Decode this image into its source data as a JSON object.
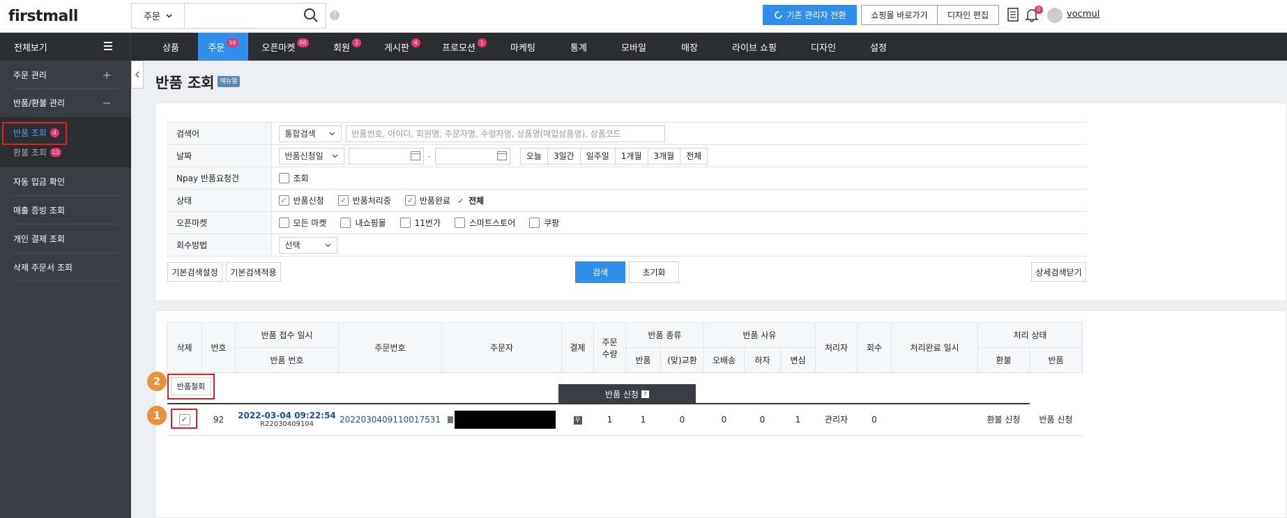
{
  "app": {
    "logo": "firstmall",
    "username": "vocmul"
  },
  "topbar": {
    "search_select": "주문",
    "help": "?",
    "switch_admin": "기존 관리자 전환",
    "go_mall": "쇼핑몰 바로가기",
    "design_edit": "디자인 편집",
    "notif_count": "0"
  },
  "nav": {
    "all": "전체보기",
    "items": [
      {
        "label": "상품",
        "badge": ""
      },
      {
        "label": "주문",
        "badge": "59"
      },
      {
        "label": "오픈마켓",
        "badge": "98"
      },
      {
        "label": "회원",
        "badge": "2"
      },
      {
        "label": "게시판",
        "badge": "4"
      },
      {
        "label": "프로모션",
        "badge": "1"
      },
      {
        "label": "마케팅",
        "badge": ""
      },
      {
        "label": "통계",
        "badge": ""
      },
      {
        "label": "모바일",
        "badge": ""
      },
      {
        "label": "매장",
        "badge": ""
      },
      {
        "label": "라이브 쇼핑",
        "badge": ""
      },
      {
        "label": "디자인",
        "badge": ""
      },
      {
        "label": "설정",
        "badge": ""
      }
    ]
  },
  "sidebar": {
    "order_mgmt": "주문 관리",
    "return_mgmt": "반품/환불 관리",
    "return_view": "반품 조회",
    "return_view_badge": "4",
    "refund_view": "환불 조회",
    "refund_view_badge": "11",
    "auto_deposit": "자동 입금 확인",
    "sales_proof": "매출 증빙 조회",
    "personal_pay": "개인 결제 조회",
    "deleted_orders": "삭제 주문서 조회",
    "plus": "+",
    "minus": "−"
  },
  "page": {
    "title": "반품 조회",
    "manual": "매뉴얼"
  },
  "search_form": {
    "keyword_label": "검색어",
    "keyword_select": "통합검색",
    "keyword_placeholder": "반품번호, 아이디, 회원명, 주문자명, 수령자명, 상품명(매입상품명), 상품코드",
    "date_label": "날짜",
    "date_select": "반품신청일",
    "date_sep": "-",
    "date_ranges": [
      "오늘",
      "3일간",
      "일주일",
      "1개월",
      "3개월",
      "전체"
    ],
    "npay_label": "Npay 반품요청건",
    "npay_check": "조회",
    "status_label": "상태",
    "status_options": [
      "반품신청",
      "반품처리중",
      "반품완료"
    ],
    "status_all": "전체",
    "market_label": "오픈마켓",
    "market_options": [
      "모든 마켓",
      "내쇼핑몰",
      "11번가",
      "스마트스토어",
      "쿠팡"
    ],
    "method_label": "회수방법",
    "method_select": "선택",
    "btn_default_set": "기본검색설정",
    "btn_default_apply": "기본검색적용",
    "btn_search": "검색",
    "btn_reset": "초기화",
    "btn_detail_close": "상세검색닫기"
  },
  "list": {
    "headers": {
      "delete": "삭제",
      "no": "번호",
      "receipt_time": "반품 접수 일시",
      "return_no": "반품 번호",
      "order_no": "주문번호",
      "orderer": "주문자",
      "payment": "결제",
      "qty": "주문\n수량",
      "return_type": "반품 종류",
      "return_type_a": "반품",
      "return_type_b": "(맞)교환",
      "reason": "반품 사유",
      "reason_a": "오배송",
      "reason_b": "하자",
      "reason_c": "변심",
      "handler": "처리자",
      "recovery": "회수",
      "done_time": "처리완료 일시",
      "status": "처리 상태",
      "status_a": "환불",
      "status_b": "반품"
    },
    "withdraw_btn": "반품철회",
    "tab_label": "반품 신청",
    "tab_help": "?",
    "rows": [
      {
        "no": "92",
        "receipt_time": "2022-03-04 09:22:54",
        "return_no": "R22030409104",
        "order_no": "2022030409110017531",
        "payment_icon": "무",
        "qty": "1",
        "type_return": "1",
        "type_exchange": "0",
        "reason_wrong": "0",
        "reason_defect": "0",
        "reason_change": "1",
        "handler": "관리자",
        "recovery": "0",
        "done_time": "",
        "status_refund": "환불 신청",
        "status_return": "반품 신청"
      }
    ]
  },
  "annotations": [
    "1",
    "2"
  ]
}
